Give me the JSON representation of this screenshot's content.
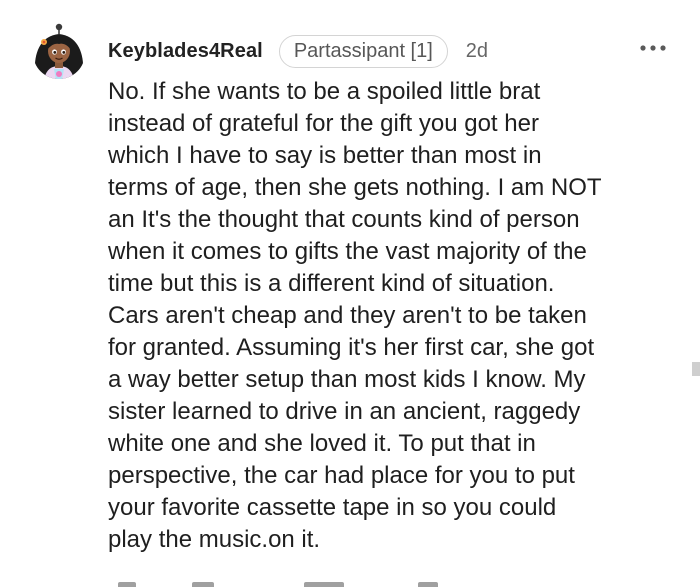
{
  "comment": {
    "username": "Keyblades4Real",
    "flair": "Partassipant [1]",
    "timestamp": "2d",
    "more_menu_icon": "more-horizontal-icon",
    "avatar_icon": "user-avatar-icon",
    "body": "No. If she wants to be a spoiled little brat\ninstead of grateful for the gift you got her\nwhich I have to say is better than most in\nterms of age, then she gets nothing. I am NOT\nan It's the thought that counts kind of person\nwhen it comes to gifts the vast majority of the\ntime but this is a different kind of situation.\nCars aren't cheap and they aren't to be taken\nfor granted. Assuming it's her first car, she got\na way better setup than most kids I know. My\nsister learned to drive in an ancient, raggedy\nwhite one and she loved it. To put that in\nperspective, the car had place for you to put\nyour favorite cassette tape in so you could\nplay the music.on it."
  },
  "colors": {
    "username": "#222222",
    "flair_text": "#575757",
    "flair_border": "#d4d4d4",
    "timestamp": "#666666",
    "body_text": "#1f1f1f",
    "background": "#ffffff"
  }
}
